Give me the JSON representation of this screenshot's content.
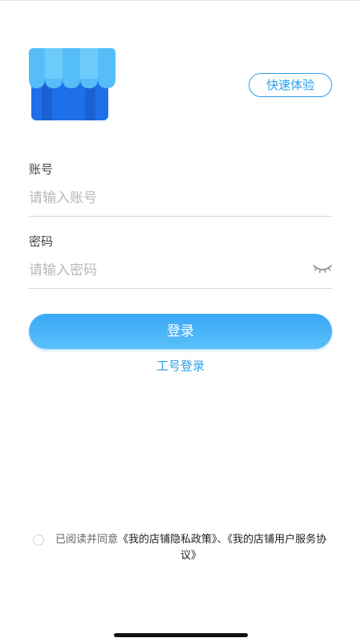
{
  "header": {
    "quick_experience_label": "快速体验"
  },
  "account": {
    "label": "账号",
    "placeholder": "请输入账号",
    "value": ""
  },
  "password": {
    "label": "密码",
    "placeholder": "请输入密码",
    "value": ""
  },
  "actions": {
    "login_label": "登录",
    "employee_login_label": "工号登录"
  },
  "agreement": {
    "checked": false,
    "prefix": "已阅读并同意",
    "privacy_policy": "《我的店铺隐私政策》",
    "separator": "、",
    "user_agreement": "《我的店铺用户服务协议》"
  },
  "icons": {
    "logo": "shop-storefront-icon",
    "password_toggle": "eye-closed-icon"
  },
  "colors": {
    "accent": "#2a9fe8",
    "button_gradient_top": "#38a8f5",
    "button_gradient_bottom": "#5bc0fa",
    "logo_awning": "#55bdf7",
    "logo_body": "#1f6fe8"
  }
}
